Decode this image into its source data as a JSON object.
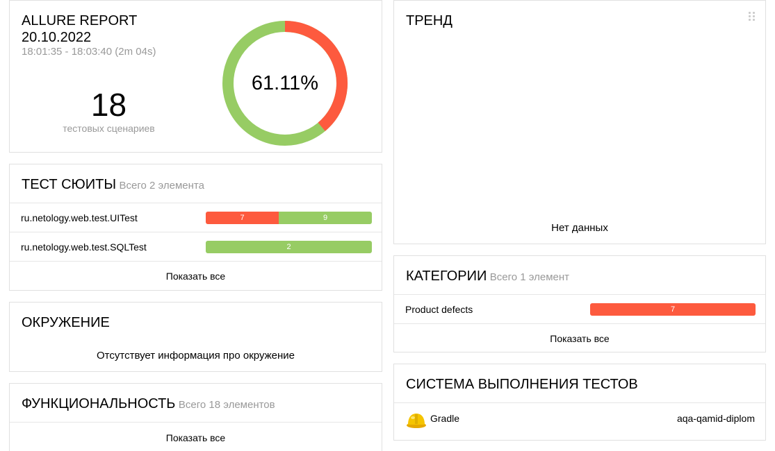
{
  "summary": {
    "title": "ALLURE REPORT",
    "date": "20.10.2022",
    "time_range": "18:01:35 - 18:03:40 (2m 04s)",
    "count": "18",
    "count_label": "тестовых сценариев",
    "percent_label": "61.11%",
    "donut": {
      "failed": 7,
      "passed": 11
    },
    "colors": {
      "failed": "#fd5a3e",
      "passed": "#97cc64"
    }
  },
  "suites": {
    "title": "ТЕСТ СЮИТЫ",
    "subtitle": "Всего 2 элемента",
    "items": [
      {
        "name": "ru.netology.web.test.UITest",
        "failed": "7",
        "passed": "9"
      },
      {
        "name": "ru.netology.web.test.SQLTest",
        "failed": "",
        "passed": "2"
      }
    ],
    "show_all": "Показать все"
  },
  "environment": {
    "title": "ОКРУЖЕНИЕ",
    "empty": "Отсутствует информация про окружение"
  },
  "features": {
    "title": "ФУНКЦИОНАЛЬНОСТЬ",
    "subtitle": "Всего 18 элементов",
    "show_all": "Показать все"
  },
  "trend": {
    "title": "ТРЕНД",
    "empty": "Нет данных",
    "handle_icon": "drag-handle-icon"
  },
  "categories": {
    "title": "КАТЕГОРИИ",
    "subtitle": "Всего 1 элемент",
    "items": [
      {
        "name": "Product defects",
        "failed": "7"
      }
    ],
    "show_all": "Показать все"
  },
  "executors": {
    "title": "СИСТЕМА ВЫПОЛНЕНИЯ ТЕСТОВ",
    "items": [
      {
        "icon": "gradle-hardhat-icon",
        "name": "Gradle",
        "build": "aqa-qamid-diplom"
      }
    ]
  }
}
